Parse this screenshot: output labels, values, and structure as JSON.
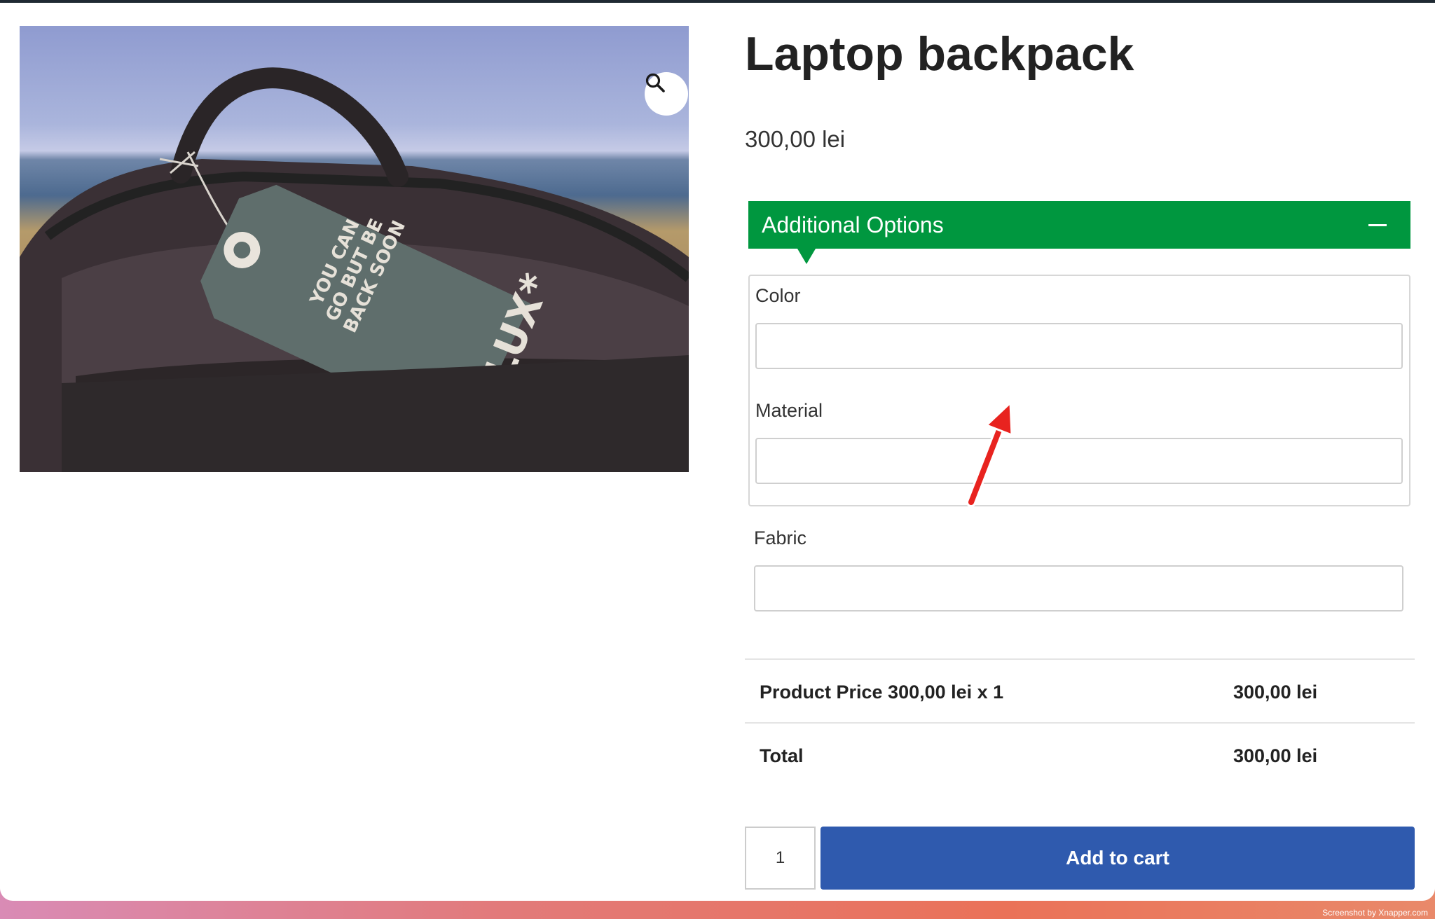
{
  "product": {
    "title": "Laptop backpack",
    "price": "300,00 lei"
  },
  "image": {
    "tag_text_lines": [
      "YOU CAN",
      "GO BUT BE",
      "BACK SOON"
    ],
    "tag_brand": "LUX*"
  },
  "options": {
    "header": "Additional Options",
    "fields": [
      {
        "label": "Color",
        "value": ""
      },
      {
        "label": "Material",
        "value": ""
      },
      {
        "label": "Fabric",
        "value": ""
      }
    ]
  },
  "totals": {
    "product_price_label": "Product Price 300,00 lei x 1",
    "product_price_value": "300,00 lei",
    "total_label": "Total",
    "total_value": "300,00 lei"
  },
  "cart": {
    "quantity": "1",
    "button_label": "Add to cart"
  },
  "credit": "Screenshot by Xnapper.com",
  "colors": {
    "accent_green": "#00973f",
    "button_blue": "#2f5aae",
    "annotation_red": "#e8231f"
  },
  "icons": {
    "zoom": "magnifier-icon",
    "collapse": "minus-icon",
    "annotation": "red-arrow-icon"
  }
}
